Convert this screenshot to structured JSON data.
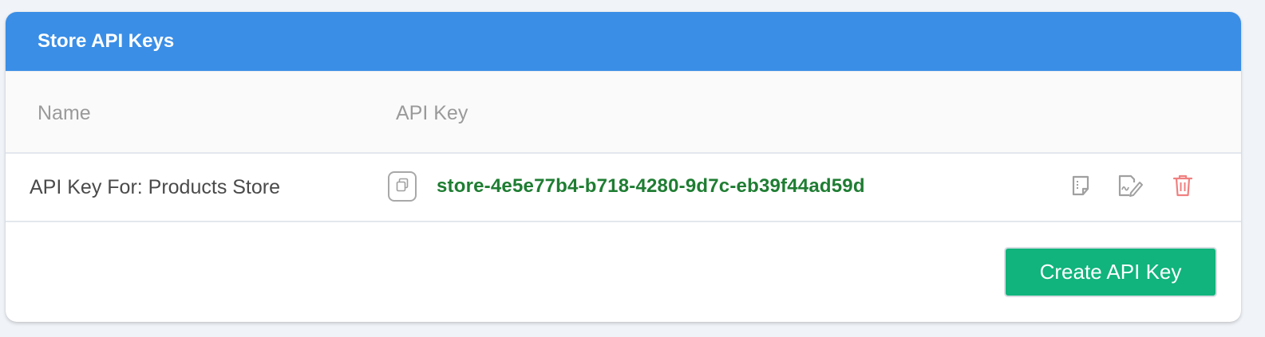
{
  "panel": {
    "title": "Store API Keys"
  },
  "table": {
    "columns": [
      "Name",
      "API Key"
    ],
    "rows": [
      {
        "name": "API Key For: Products Store",
        "api_key": "store-4e5e77b4-b718-4280-9d7c-eb39f44ad59d",
        "actions": [
          "copy-icon",
          "notes-icon",
          "edit-signature-icon",
          "trash-icon"
        ]
      }
    ]
  },
  "footer": {
    "create_label": "Create API Key"
  },
  "colors": {
    "header_bg": "#3a8ee6",
    "api_key_text": "#1e7d32",
    "create_button_bg": "#10b47c",
    "delete_icon": "#f08080",
    "icon_gray": "#a0a0a0"
  }
}
